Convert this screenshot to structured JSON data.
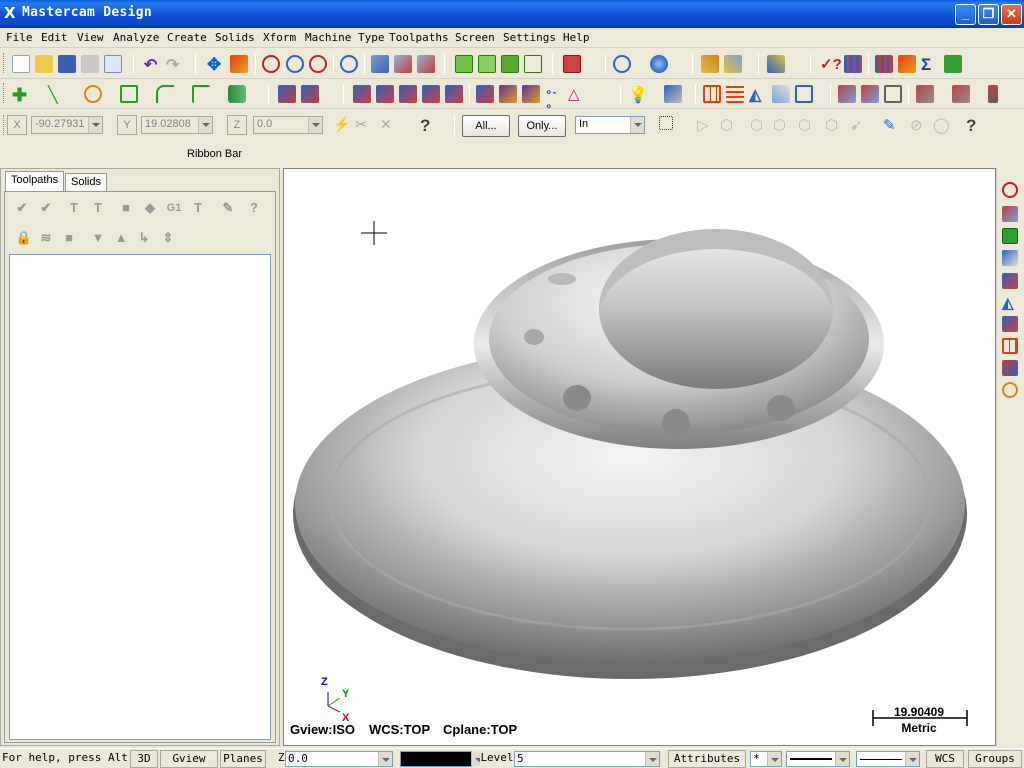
{
  "window": {
    "title": "Mastercam Design",
    "app_icon": "X"
  },
  "menu": [
    "File",
    "Edit",
    "View",
    "Analyze",
    "Create",
    "Solids",
    "Xform",
    "Machine Type",
    "Toolpaths",
    "Screen",
    "Settings",
    "Help"
  ],
  "ribbon": {
    "x_label": "X",
    "x_value": "-90.27931",
    "y_label": "Y",
    "y_value": "19.02808",
    "z_label": "Z",
    "z_value": "0.0",
    "all_label": "All...",
    "only_label": "Only...",
    "mode_value": "In",
    "help_icon": "?",
    "title": "Ribbon Bar"
  },
  "left_panel": {
    "tabs": [
      "Toolpaths",
      "Solids"
    ],
    "active_tab": "Toolpaths",
    "g1_label": "G1"
  },
  "viewport": {
    "gview": "Gview:ISO",
    "wcs": "WCS:TOP",
    "cplane": "Cplane:TOP",
    "scale_value": "19.90409",
    "scale_unit": "Metric",
    "axis_z": "Z",
    "axis_y": "Y",
    "axis_x": "X"
  },
  "statusbar": {
    "help_text": "For help, press Alt+H",
    "btn_3d": "3D",
    "btn_gview": "Gview",
    "btn_planes": "Planes",
    "z_label": "Z",
    "z_value": "0.0",
    "level_label": "Level",
    "level_value": "5",
    "attributes": "Attributes",
    "style_value": "*",
    "wcs": "WCS",
    "groups": "Groups"
  },
  "colors": {
    "titlebar": "#0a5fd8",
    "chrome": "#ece9d8",
    "viewport_bg": "#ffffff",
    "axis_x": "#e00000",
    "axis_y": "#00a000",
    "axis_z": "#0000d0"
  }
}
